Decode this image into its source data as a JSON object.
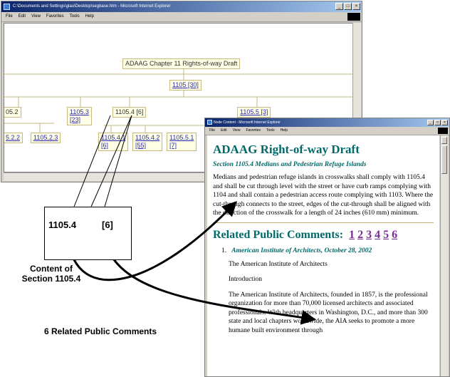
{
  "tree_window": {
    "title": "C:\\Documents and Settings\\glau\\Desktop\\segbase.htm - Microsoft Internet Explorer",
    "menu": [
      "File",
      "Edit",
      "View",
      "Favorites",
      "Tools",
      "Help"
    ],
    "controls": [
      "_",
      "□",
      "×"
    ],
    "nodes": {
      "root": "ADAAG Chapter 11 Rights-of-way Draft",
      "n1105": "1105 [30]",
      "n1105_2": "05.2",
      "n1105_3": "1105.3\n[23]",
      "n1105_4": "1105.4 [6]",
      "n1105_5": "1105.5 [3]",
      "n1105_2_2": "5.2.2",
      "n1105_2_3": "1105.2.3",
      "n1105_4_1": "1105.4.1\n[6]",
      "n1105_4_2": "1105.4.2\n[55]",
      "n1105_5_1": "1105.5.1\n[7]"
    }
  },
  "content_window": {
    "title": "Node Content - Microsoft Internet Explorer",
    "menu": [
      "File",
      "Edit",
      "View",
      "Favorites",
      "Tools",
      "Help"
    ],
    "controls": [
      "_",
      "□",
      "×"
    ],
    "doc_title": "ADAAG Right-of-way Draft",
    "section_heading": "Section 1105.4 Medians and Pedestrian Refuge Islands",
    "section_body": "Medians and pedestrian refuge islands in crosswalks shall comply with 1105.4 and shall be cut through level with the street or have curb ramps complying with 1104 and shall contain a pedestrian access route complying with 1103. Where the cut-through connects to the street, edges of the cut-through shall be aligned with the direction of the crosswalk for a length of 24 inches (610 mm) minimum.",
    "related_label": "Related Public Comments:",
    "related_links": [
      "1",
      "2",
      "3",
      "4",
      "5",
      "6"
    ],
    "comment_number": "1.",
    "comment_source": "American Institute of Architects, October 28, 2002",
    "comment_org": "The American Institute of Architects",
    "comment_intro": "Introduction",
    "comment_text": "The American Institute of Architects, founded in 1857, is the professional organization for more than 70,000 licensed architects and associated professionals. With headquarters in Washington, D.C., and more than 300 state and local chapters worldwide, the AIA seeks to promote a more humane built environment through"
  },
  "callouts": {
    "zoom_section_id": "1105.4",
    "zoom_comment_count": "[6]",
    "caption_content": "Content of\nSection 1105.4",
    "caption_comments": "6 Related Public Comments"
  }
}
